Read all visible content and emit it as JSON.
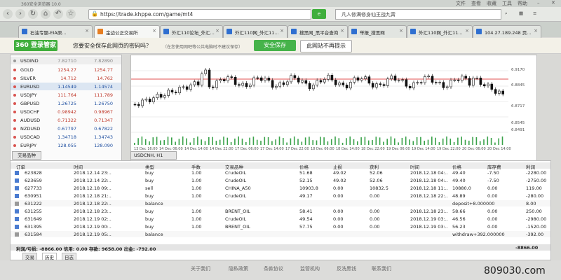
{
  "window": {
    "title": "360安全浏览器 10.0",
    "controls": [
      "文件",
      "查看",
      "收藏",
      "工具",
      "帮助"
    ]
  },
  "address": {
    "url": "https://trade.khppe.com/game/mt4",
    "search_text": "凡人修满修身仙王战九霄"
  },
  "tabs": [
    {
      "label": "石油专题-EIA原..."
    },
    {
      "label": "金边公正交易所",
      "active": true
    },
    {
      "label": "外汇110论坛_外汇..."
    },
    {
      "label": "外汇110网_外汇11..."
    },
    {
      "label": "搜黑网_黑平台查询"
    },
    {
      "label": "举报_搜黑网"
    },
    {
      "label": "外汇110网_外汇11..."
    },
    {
      "label": "104.27.189.248 页..."
    }
  ],
  "savebar": {
    "brand": "360 登录管家",
    "question": "您要安全保存此网页的密码吗？",
    "hint": "（在您使用网吧等公共电脑时不建议保存）",
    "save_label": "安全保存",
    "noprompt_label": "此网站不再提示"
  },
  "watch": {
    "header": {
      "sym": "USDIND",
      "bid": "7.82710",
      "ask": "7.82890"
    },
    "rows": [
      {
        "sym": "GOLD",
        "bid": "1254.27",
        "ask": "1254.77"
      },
      {
        "sym": "SILVER",
        "bid": "14.712",
        "ask": "14.762"
      },
      {
        "sym": "EURUSD",
        "bid": "1.14549",
        "ask": "1.14574"
      },
      {
        "sym": "USDJPY",
        "bid": "111.764",
        "ask": "111.789"
      },
      {
        "sym": "GBPUSD",
        "bid": "1.26725",
        "ask": "1.26750"
      },
      {
        "sym": "USDCHF",
        "bid": "0.98942",
        "ask": "0.98967"
      },
      {
        "sym": "AUDUSD",
        "bid": "0.71322",
        "ask": "0.71347"
      },
      {
        "sym": "NZDUSD",
        "bid": "0.67797",
        "ask": "0.67822"
      },
      {
        "sym": "USDCAD",
        "bid": "1.34718",
        "ask": "1.34743"
      },
      {
        "sym": "EURJPY",
        "bid": "128.055",
        "ask": "128.090"
      }
    ],
    "tab_label": "交易品种"
  },
  "chart": {
    "symbol_tab": "USDCNH, H1",
    "dates": [
      "13 Dec 16:00",
      "14 Dec 06:00",
      "14 Dec 14:00",
      "14 Dec 22:00",
      "17 Dec 06:00",
      "17 Dec 14:00",
      "17 Dec 22:00",
      "18 Dec 06:00",
      "18 Dec 14:00",
      "18 Dec 22:00",
      "19 Dec 06:00",
      "19 Dec 14:00",
      "19 Dec 22:00",
      "20 Dec 06:00",
      "20 Dec 14:00"
    ],
    "price_labels": [
      "6.9170",
      "6.8845",
      "6.8717",
      "6.8545",
      "6.8491"
    ]
  },
  "terminal": {
    "headers": [
      "订单",
      "时间",
      "类型",
      "手数",
      "交易品种",
      "价格",
      "止损",
      "获利",
      "时间",
      "价格",
      "库存费",
      "利润"
    ],
    "rows": [
      {
        "id": "623828",
        "time": "2018.12.14 23:..",
        "type": "buy",
        "lots": "1.00",
        "symbol": "CrudeOIL",
        "price": "51.68",
        "sl": "49.02",
        "tp": "52.06",
        "ctime": "2018.12.18 04:..",
        "cprice": "49.40",
        "swap": "-7.50",
        "profit": "-2280.00"
      },
      {
        "id": "623659",
        "time": "2018.12.14 22:..",
        "type": "buy",
        "lots": "1.00",
        "symbol": "CrudeOIL",
        "price": "52.15",
        "sl": "49.02",
        "tp": "52.06",
        "ctime": "2018.12.18 04:..",
        "cprice": "49.40",
        "swap": "-7.50",
        "profit": "-2750.00"
      },
      {
        "id": "627733",
        "time": "2018.12.18 09:..",
        "type": "sell",
        "lots": "1.00",
        "symbol": "CHINA_A50",
        "price": "10903.8",
        "sl": "0.00",
        "tp": "10832.5",
        "ctime": "2018.12.18 11:..",
        "cprice": "10880.0",
        "swap": "0.00",
        "profit": "119.00"
      },
      {
        "id": "630951",
        "time": "2018.12.18 21:..",
        "type": "buy",
        "lots": "1.00",
        "symbol": "CrudeOIL",
        "price": "49.17",
        "sl": "0.00",
        "tp": "0.00",
        "ctime": "2018.12.18 22:..",
        "cprice": "48.89",
        "swap": "0.00",
        "profit": "-280.00"
      },
      {
        "id": "631222",
        "time": "2018.12.18 22:..",
        "type": "balance",
        "lots": "",
        "symbol": "",
        "price": "",
        "sl": "",
        "tp": "",
        "ctime": "",
        "cprice": "deposit+8.000000",
        "swap": "",
        "profit": "8.00"
      },
      {
        "id": "631255",
        "time": "2018.12.18 23:..",
        "type": "buy",
        "lots": "1.00",
        "symbol": "BRENT_OIL",
        "price": "58.41",
        "sl": "0.00",
        "tp": "0.00",
        "ctime": "2018.12.18 23:..",
        "cprice": "58.66",
        "swap": "0.00",
        "profit": "250.00"
      },
      {
        "id": "631649",
        "time": "2018.12.19 02:..",
        "type": "buy",
        "lots": "1.00",
        "symbol": "CrudeOIL",
        "price": "49.54",
        "sl": "0.00",
        "tp": "0.00",
        "ctime": "2018.12.19 03:..",
        "cprice": "46.56",
        "swap": "0.00",
        "profit": "-2980.00"
      },
      {
        "id": "631395",
        "time": "2018.12.19 00:..",
        "type": "buy",
        "lots": "1.00",
        "symbol": "BRENT_OIL",
        "price": "57.75",
        "sl": "0.00",
        "tp": "0.00",
        "ctime": "2018.12.19 03:..",
        "cprice": "56.23",
        "swap": "0.00",
        "profit": "-1520.00"
      },
      {
        "id": "631584",
        "time": "2018.12.19 05:..",
        "type": "balance",
        "lots": "",
        "symbol": "",
        "price": "",
        "sl": "",
        "tp": "",
        "ctime": "",
        "cprice": "withdraw+392.000000",
        "swap": "",
        "profit": "-392.00"
      }
    ],
    "summary": "利润/亏损: -8866.00  信用: 0.00  存款: 9658.00  出金: -792.00",
    "summary_total": "-8866.00",
    "tabs": [
      "交易",
      "历史",
      "日志"
    ]
  },
  "footer": {
    "links": [
      "关于我们",
      "隐私政策",
      "条款协议",
      "监管机构",
      "反洗黑钱",
      "联系我们"
    ],
    "watermark": "809030.com"
  }
}
